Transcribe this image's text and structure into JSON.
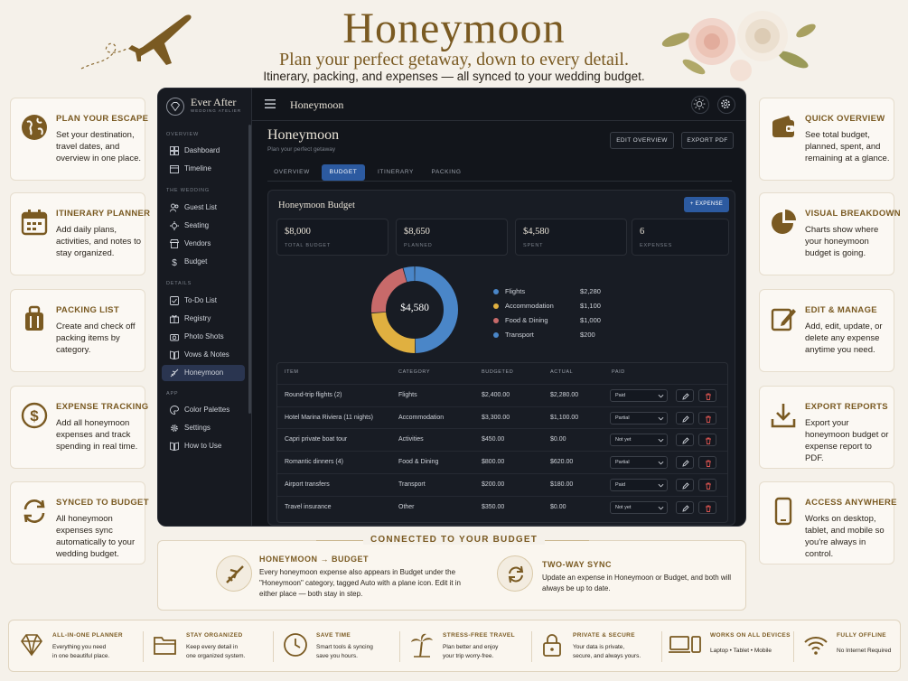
{
  "hero": {
    "title": "Honeymoon",
    "subtitle": "Plan your perfect getaway, down to every detail.",
    "tagline": "Itinerary, packing, and expenses — all synced to your wedding budget."
  },
  "left_features": [
    {
      "title": "PLAN YOUR ESCAPE",
      "desc": "Set your destination, travel dates, and overview in one place.",
      "icon": "globe-icon"
    },
    {
      "title": "ITINERARY PLANNER",
      "desc": "Add daily plans, activities, and notes to stay organized.",
      "icon": "calendar-icon"
    },
    {
      "title": "PACKING LIST",
      "desc": "Create and check off packing items by category.",
      "icon": "suitcase-icon"
    },
    {
      "title": "EXPENSE TRACKING",
      "desc": "Add all honeymoon expenses and track spending in real time.",
      "icon": "dollar-icon"
    },
    {
      "title": "SYNCED TO BUDGET",
      "desc": "All honeymoon expenses sync automatically to your wedding budget.",
      "icon": "sync-icon"
    }
  ],
  "right_features": [
    {
      "title": "QUICK OVERVIEW",
      "desc": "See total budget, planned, spent, and remaining at a glance.",
      "icon": "wallet-icon"
    },
    {
      "title": "VISUAL BREAKDOWN",
      "desc": "Charts show where your honeymoon budget is going.",
      "icon": "pie-chart-icon"
    },
    {
      "title": "EDIT & MANAGE",
      "desc": "Add, edit, update, or delete any expense anytime you need.",
      "icon": "edit-icon"
    },
    {
      "title": "EXPORT REPORTS",
      "desc": "Export your honeymoon budget or expense report to PDF.",
      "icon": "download-icon"
    },
    {
      "title": "ACCESS ANYWHERE",
      "desc": "Works on desktop, tablet, and mobile so you're always in control.",
      "icon": "phone-icon"
    }
  ],
  "app": {
    "brand": {
      "name": "Ever After",
      "tag": "WEDDING ATELIER"
    },
    "sidebar": {
      "sections": [
        {
          "label": "OVERVIEW",
          "items": [
            {
              "label": "Dashboard",
              "icon": "dashboard-icon"
            },
            {
              "label": "Timeline",
              "icon": "calendar-icon"
            }
          ]
        },
        {
          "label": "THE WEDDING",
          "items": [
            {
              "label": "Guest List",
              "icon": "users-icon"
            },
            {
              "label": "Seating",
              "icon": "seating-icon"
            },
            {
              "label": "Vendors",
              "icon": "store-icon"
            },
            {
              "label": "Budget",
              "icon": "dollar-icon"
            }
          ]
        },
        {
          "label": "DETAILS",
          "items": [
            {
              "label": "To-Do List",
              "icon": "checklist-icon"
            },
            {
              "label": "Registry",
              "icon": "gift-icon"
            },
            {
              "label": "Photo Shots",
              "icon": "camera-icon"
            },
            {
              "label": "Vows & Notes",
              "icon": "book-icon"
            },
            {
              "label": "Honeymoon",
              "icon": "plane-icon"
            }
          ]
        },
        {
          "label": "APP",
          "items": [
            {
              "label": "Color Palettes",
              "icon": "palette-icon"
            },
            {
              "label": "Settings",
              "icon": "gear-icon"
            },
            {
              "label": "How to Use",
              "icon": "book-icon"
            }
          ]
        }
      ],
      "active": "Honeymoon"
    },
    "topbar": {
      "title": "Honeymoon"
    },
    "page": {
      "title": "Honeymoon",
      "subtitle": "Plan your perfect getaway"
    },
    "buttons": {
      "edit_overview": "EDIT OVERVIEW",
      "export_pdf": "EXPORT PDF",
      "add_expense": "+ EXPENSE"
    },
    "tabs": [
      {
        "label": "OVERVIEW",
        "active": false
      },
      {
        "label": "BUDGET",
        "active": true
      },
      {
        "label": "ITINERARY",
        "active": false
      },
      {
        "label": "PACKING",
        "active": false
      }
    ],
    "budget": {
      "title": "Honeymoon Budget",
      "stats": [
        {
          "value": "$8,000",
          "label": "TOTAL BUDGET"
        },
        {
          "value": "$8,650",
          "label": "PLANNED"
        },
        {
          "value": "$4,580",
          "label": "SPENT"
        },
        {
          "value": "6",
          "label": "EXPENSES"
        }
      ],
      "donut_center": "$4,580"
    },
    "table": {
      "headers": [
        "ITEM",
        "CATEGORY",
        "BUDGETED",
        "ACTUAL",
        "PAID"
      ],
      "rows": [
        {
          "item": "Round-trip flights (2)",
          "category": "Flights",
          "budgeted": "$2,400.00",
          "actual": "$2,280.00",
          "paid": "Paid"
        },
        {
          "item": "Hotel Marina Riviera (11 nights)",
          "category": "Accommodation",
          "budgeted": "$3,300.00",
          "actual": "$1,100.00",
          "paid": "Partial"
        },
        {
          "item": "Capri private boat tour",
          "category": "Activities",
          "budgeted": "$450.00",
          "actual": "$0.00",
          "paid": "Not yet"
        },
        {
          "item": "Romantic dinners (4)",
          "category": "Food & Dining",
          "budgeted": "$800.00",
          "actual": "$620.00",
          "paid": "Partial"
        },
        {
          "item": "Airport transfers",
          "category": "Transport",
          "budgeted": "$200.00",
          "actual": "$180.00",
          "paid": "Paid"
        },
        {
          "item": "Travel insurance",
          "category": "Other",
          "budgeted": "$350.00",
          "actual": "$0.00",
          "paid": "Not yet"
        }
      ]
    }
  },
  "chart_data": {
    "type": "pie",
    "categories": [
      "Flights",
      "Accommodation",
      "Food & Dining",
      "Transport"
    ],
    "values": [
      2280,
      1100,
      1000,
      200
    ],
    "value_labels": [
      "$2,280",
      "$1,100",
      "$1,000",
      "$200"
    ],
    "colors": [
      "#4a86c8",
      "#e0b040",
      "#c86a6a",
      "#4a86c8"
    ],
    "center_label": "$4,580",
    "legend": "right"
  },
  "connected": {
    "title": "CONNECTED TO YOUR BUDGET",
    "left": {
      "title": "HONEYMOON → BUDGET",
      "desc": "Every honeymoon expense also appears in Budget under the \"Honeymoon\" category, tagged Auto with a plane icon. Edit it in either place — both stay in step.",
      "icon": "plane-icon"
    },
    "right": {
      "title": "TWO-WAY SYNC",
      "desc": "Update an expense in Honeymoon or Budget, and both will always be up to date.",
      "icon": "sync-icon"
    }
  },
  "strip": [
    {
      "title": "ALL-IN-ONE PLANNER",
      "desc": [
        "Everything you need",
        "in one beautiful place."
      ],
      "icon": "diamond-icon"
    },
    {
      "title": "STAY ORGANIZED",
      "desc": [
        "Keep every detail in",
        "one organized system."
      ],
      "icon": "folder-icon"
    },
    {
      "title": "SAVE TIME",
      "desc": [
        "Smart tools & syncing",
        "save you hours."
      ],
      "icon": "clock-icon"
    },
    {
      "title": "STRESS-FREE TRAVEL",
      "desc": [
        "Plan better and enjoy",
        "your trip worry-free."
      ],
      "icon": "palm-icon"
    },
    {
      "title": "PRIVATE & SECURE",
      "desc": [
        "Your data is private,",
        "secure, and always yours."
      ],
      "icon": "lock-icon"
    },
    {
      "title": "WORKS ON ALL DEVICES",
      "desc": [
        "Laptop  •  Tablet  •  Mobile"
      ],
      "icon": "devices-icon"
    },
    {
      "title": "FULLY OFFLINE",
      "desc": [
        "No Internet Required"
      ],
      "icon": "wifi-icon"
    }
  ]
}
